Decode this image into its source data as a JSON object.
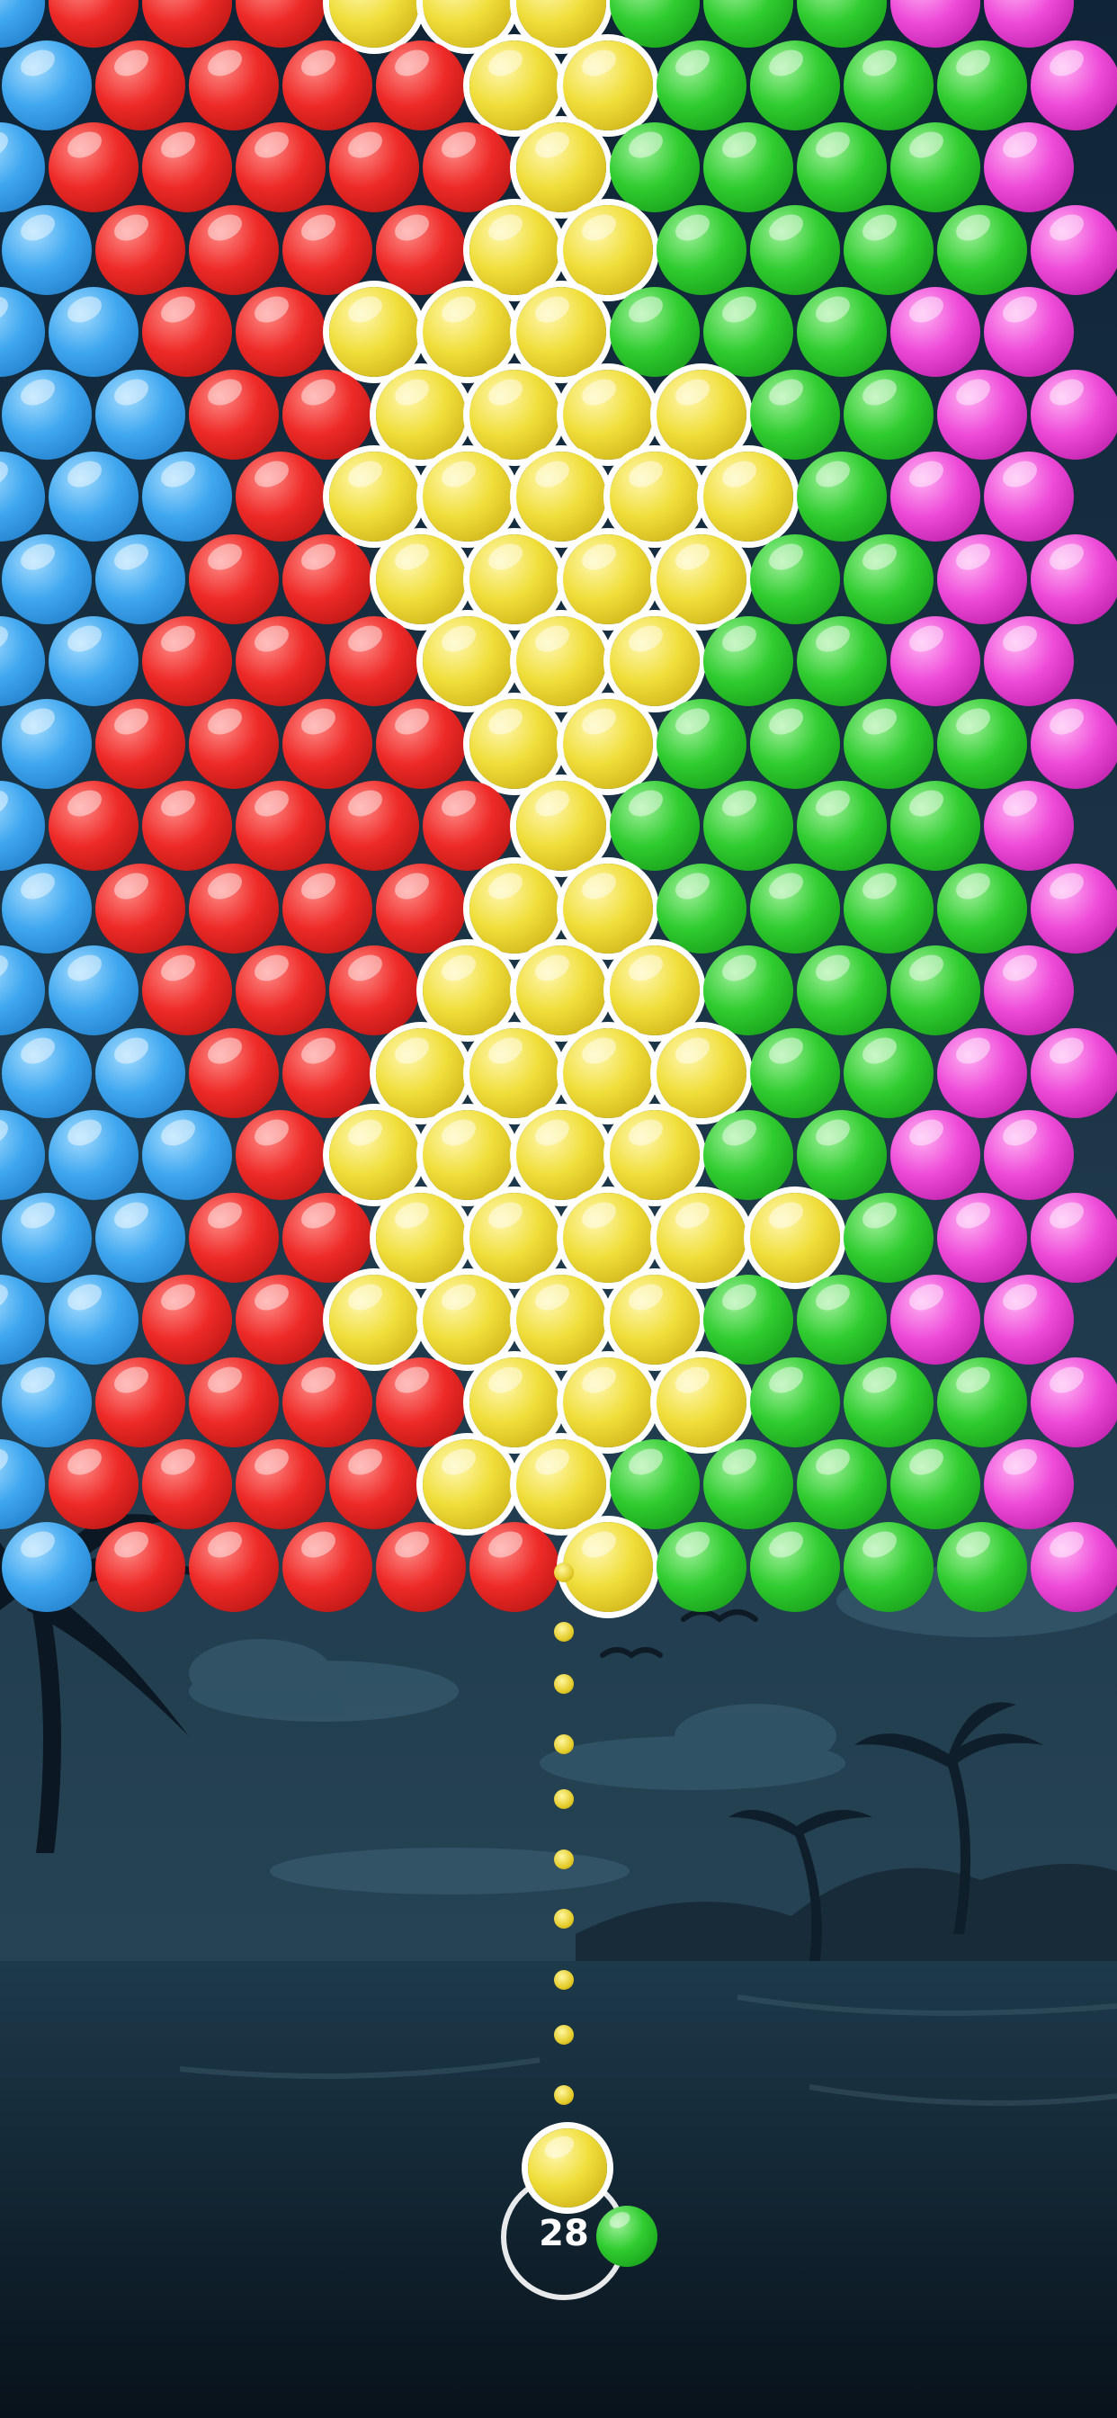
{
  "game": {
    "shots_remaining": "28",
    "current_bubble_color": "yellow",
    "next_bubble_color": "green"
  },
  "colors": {
    "blue": "#3fa7ef",
    "red": "#ee2a27",
    "yellow": "#f0de3a",
    "green": "#2fcc2f",
    "magenta": "#ee4ad8",
    "sky_top": "#0e2132",
    "sea": "#1c3547"
  },
  "board": {
    "rows": [
      [
        "B",
        "R",
        "R",
        "R",
        "Y",
        "Y",
        "Y",
        "G",
        "G",
        "G",
        "M",
        "M"
      ],
      [
        "B",
        "R",
        "R",
        "R",
        "R",
        "Y",
        "Y",
        "G",
        "G",
        "G",
        "G",
        "M"
      ],
      [
        "B",
        "R",
        "R",
        "R",
        "R",
        "R",
        "Y",
        "G",
        "G",
        "G",
        "G",
        "M"
      ],
      [
        "B",
        "R",
        "R",
        "R",
        "R",
        "Y",
        "Y",
        "G",
        "G",
        "G",
        "G",
        "M"
      ],
      [
        "B",
        "B",
        "R",
        "R",
        "Y",
        "Y",
        "Y",
        "G",
        "G",
        "G",
        "M",
        "M"
      ],
      [
        "B",
        "B",
        "R",
        "R",
        "Y",
        "Y",
        "Y",
        "Y",
        "G",
        "G",
        "M",
        "M"
      ],
      [
        "B",
        "B",
        "B",
        "R",
        "Y",
        "Y",
        "Y",
        "Y",
        "Y",
        "G",
        "M",
        "M"
      ],
      [
        "B",
        "B",
        "R",
        "R",
        "Y",
        "Y",
        "Y",
        "Y",
        "G",
        "G",
        "M",
        "M"
      ],
      [
        "B",
        "B",
        "R",
        "R",
        "R",
        "Y",
        "Y",
        "Y",
        "G",
        "G",
        "M",
        "M"
      ],
      [
        "B",
        "R",
        "R",
        "R",
        "R",
        "Y",
        "Y",
        "G",
        "G",
        "G",
        "G",
        "M"
      ],
      [
        "B",
        "R",
        "R",
        "R",
        "R",
        "R",
        "Y",
        "G",
        "G",
        "G",
        "G",
        "M"
      ],
      [
        "B",
        "R",
        "R",
        "R",
        "R",
        "Y",
        "Y",
        "G",
        "G",
        "G",
        "G",
        "M"
      ],
      [
        "B",
        "B",
        "R",
        "R",
        "R",
        "Y",
        "Y",
        "Y",
        "G",
        "G",
        "G",
        "M"
      ],
      [
        "B",
        "B",
        "R",
        "R",
        "Y",
        "Y",
        "Y",
        "Y",
        "G",
        "G",
        "M",
        "M"
      ],
      [
        "B",
        "B",
        "B",
        "R",
        "Y",
        "Y",
        "Y",
        "Y",
        "G",
        "G",
        "M",
        "M"
      ],
      [
        "B",
        "B",
        "R",
        "R",
        "Y",
        "Y",
        "Y",
        "Y",
        "Y",
        "G",
        "M",
        "M"
      ],
      [
        "B",
        "B",
        "R",
        "R",
        "Y",
        "Y",
        "Y",
        "Y",
        "G",
        "G",
        "M",
        "M"
      ],
      [
        "B",
        "R",
        "R",
        "R",
        "R",
        "Y",
        "Y",
        "Y",
        "G",
        "G",
        "G",
        "M"
      ],
      [
        "B",
        "R",
        "R",
        "R",
        "R",
        "Y",
        "Y",
        "G",
        "G",
        "G",
        "G",
        "M"
      ],
      [
        "B",
        "R",
        "R",
        "R",
        "R",
        "R",
        "Y",
        "G",
        "G",
        "G",
        "G",
        "M"
      ]
    ]
  }
}
